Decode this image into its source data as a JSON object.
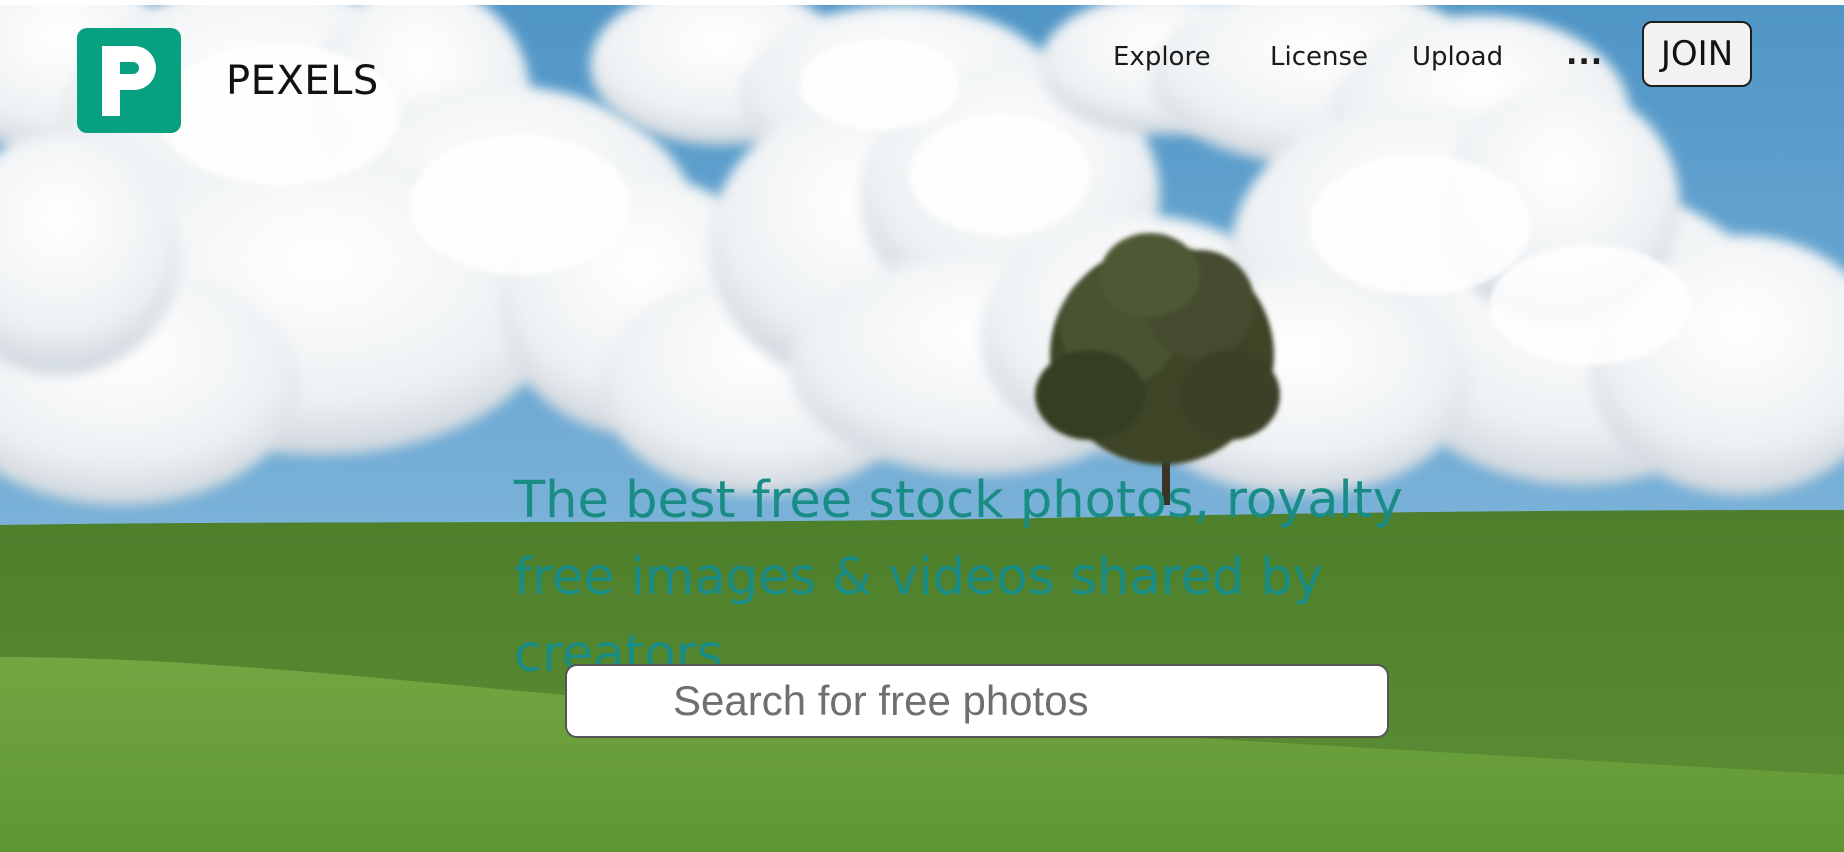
{
  "header": {
    "brand_name": "PEXELS",
    "logo_icon": "pexels-p-logo",
    "nav": {
      "explore": "Explore",
      "license": "License",
      "upload": "Upload",
      "more": "..."
    },
    "join_label": "JOIN"
  },
  "hero": {
    "headline": "The best free stock photos, royalty free images & videos shared by creators.",
    "background": "sky-clouds-lone-tree-green-hill"
  },
  "search": {
    "placeholder": "Search for free photos",
    "value": ""
  },
  "colors": {
    "brand": "#07a081",
    "headline": "#1a8c86",
    "sky": "#5e9ec9",
    "grass": "#5a9237"
  }
}
